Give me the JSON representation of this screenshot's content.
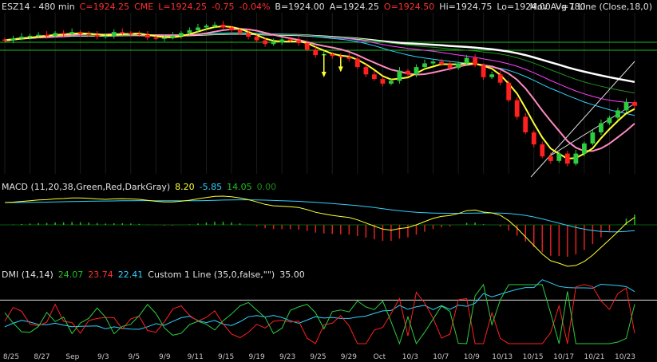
{
  "colors": {
    "background": "#000000",
    "up": "#2ecc40",
    "down": "#ff2020",
    "text": "#e0e0e0",
    "white": "#ffffff",
    "yellow": "#ffff30",
    "pink": "#ff8ac0",
    "magenta": "#ff40ff",
    "cyan": "#30d0ff",
    "green_line": "#20c020",
    "macd_line": "#ffff30",
    "macd_signal": "#30d0ff",
    "hist_up": "#20c020",
    "hist_down": "#e02020"
  },
  "price_header": {
    "symbol": "ESZ14 - 480 min",
    "close": "C=1924.25",
    "exchange": "CME",
    "last": "L=1924.25",
    "change": "-0.75",
    "change_pct": "-0.04%",
    "bid": "B=1924.00",
    "ask": "A=1924.25",
    "open": "O=1924.50",
    "high": "Hi=1924.75",
    "low": "Lo=1924.00",
    "volume": "V=780",
    "study": "Mov Avg 1 Line (Close,18,0)"
  },
  "macd_header": {
    "study": "MACD (11,20,38,Green,Red,DarkGray)",
    "macd": "8.20",
    "signal": "-5.85",
    "diff": "14.05",
    "zero": "0.00"
  },
  "dmi_header": {
    "study": "DMI (14,14)",
    "adx": "24.07",
    "plus_di": "23.74",
    "minus_di": "22.41",
    "custom": "Custom 1 Line (35,0,false,\"\")",
    "custom_value": "35.00"
  },
  "x_axis": [
    "8/25",
    "8/27",
    "Sep",
    "9/3",
    "9/5",
    "9/9",
    "9/11",
    "9/15",
    "9/19",
    "9/23",
    "9/25",
    "9/29",
    "Oct",
    "10/3",
    "10/7",
    "10/9",
    "10/13",
    "10/15",
    "10/17",
    "10/21",
    "10/23"
  ],
  "chart_data": {
    "type": "candlestick",
    "symbol": "ESZ14 - 480 min",
    "x_labels": [
      "8/25",
      "8/27",
      "Sep",
      "9/3",
      "9/5",
      "9/9",
      "9/11",
      "9/15",
      "9/19",
      "9/23",
      "9/25",
      "9/29",
      "Oct",
      "10/3",
      "10/7",
      "10/9",
      "10/13",
      "10/15",
      "10/17",
      "10/21",
      "10/23"
    ],
    "close_series": [
      1995,
      1997,
      1999,
      2000,
      2001,
      2000,
      2003,
      2002,
      2004,
      2002,
      2001,
      1999,
      2000,
      2004,
      2003,
      2002,
      2001,
      1998,
      1997,
      1998,
      2000,
      2003,
      2006,
      2009,
      2011,
      2012,
      2009,
      2006,
      2003,
      1999,
      1995,
      1991,
      1993,
      1996,
      1995,
      1992,
      1985,
      1979,
      1980,
      1978,
      1977,
      1975,
      1966,
      1958,
      1953,
      1948,
      1951,
      1962,
      1958,
      1966,
      1970,
      1972,
      1969,
      1965,
      1970,
      1976,
      1968,
      1955,
      1958,
      1949,
      1930,
      1912,
      1895,
      1882,
      1869,
      1864,
      1872,
      1861,
      1872,
      1883,
      1895,
      1905,
      1911,
      1919,
      1928,
      1924
    ],
    "grid": false
  }
}
